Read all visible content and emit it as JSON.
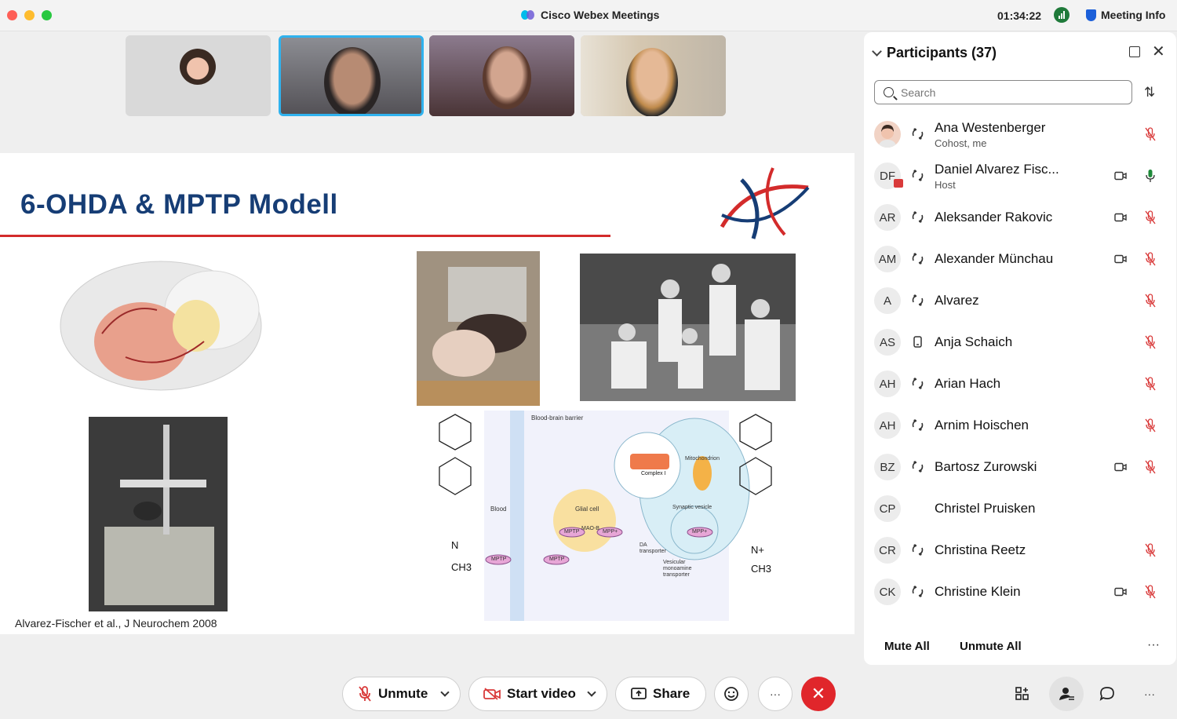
{
  "app": {
    "title": "Cisco Webex Meetings",
    "clock": "01:34:22",
    "meeting_info_label": "Meeting Info"
  },
  "slide": {
    "title": "6-OHDA & MPTP Modell",
    "citation": "Alvarez-Fischer et al., J Neurochem 2008",
    "diagram_labels": {
      "bbb": "Blood-brain barrier",
      "mito": "Mitochondrion",
      "complex": "Complex I",
      "synaptic": "Synaptic vesicle",
      "blood": "Blood",
      "glial": "Glial cell",
      "maob": "MAO-B",
      "mptp": "MPTP",
      "mpp": "MPP+",
      "da": "DA transporter",
      "vmat": "Vesicular monoamine transporter",
      "n": "N",
      "ch3": "CH3",
      "nplus": "N+"
    }
  },
  "participants": {
    "title": "Participants (37)",
    "search_placeholder": "Search",
    "mute_all": "Mute All",
    "unmute_all": "Unmute All",
    "more": "···",
    "list": [
      {
        "initials": "",
        "name": "Ana Westenberger",
        "role": "Cohost, me",
        "audio": "headset",
        "video": false,
        "mic": "muted"
      },
      {
        "initials": "DF",
        "name": "Daniel Alvarez Fisc...",
        "role": "Host",
        "audio": "headset",
        "video": true,
        "mic": "active"
      },
      {
        "initials": "AR",
        "name": "Aleksander Rakovic",
        "role": "",
        "audio": "headset",
        "video": true,
        "mic": "muted"
      },
      {
        "initials": "AM",
        "name": "Alexander Münchau",
        "role": "",
        "audio": "headset",
        "video": true,
        "mic": "muted"
      },
      {
        "initials": "A",
        "name": "Alvarez",
        "role": "",
        "audio": "headset",
        "video": false,
        "mic": "muted"
      },
      {
        "initials": "AS",
        "name": "Anja Schaich",
        "role": "",
        "audio": "phone",
        "video": false,
        "mic": "muted"
      },
      {
        "initials": "AH",
        "name": "Arian Hach",
        "role": "",
        "audio": "headset",
        "video": false,
        "mic": "muted"
      },
      {
        "initials": "AH",
        "name": "Arnim Hoischen",
        "role": "",
        "audio": "headset",
        "video": false,
        "mic": "muted"
      },
      {
        "initials": "BZ",
        "name": "Bartosz Zurowski",
        "role": "",
        "audio": "headset",
        "video": true,
        "mic": "muted"
      },
      {
        "initials": "CP",
        "name": "Christel Pruisken",
        "role": "",
        "audio": "none",
        "video": false,
        "mic": "none"
      },
      {
        "initials": "CR",
        "name": "Christina Reetz",
        "role": "",
        "audio": "headset",
        "video": false,
        "mic": "muted"
      },
      {
        "initials": "CK",
        "name": "Christine Klein",
        "role": "",
        "audio": "headset",
        "video": true,
        "mic": "muted"
      }
    ]
  },
  "controls": {
    "unmute": "Unmute",
    "start_video": "Start video",
    "share": "Share",
    "more": "···",
    "end": "✕"
  },
  "colors": {
    "accent_blue": "#2fb2ee",
    "end_red": "#e0262b",
    "slide_title": "#163d75",
    "muted_red": "#d93a3a",
    "mic_green": "#1f8a3a"
  }
}
